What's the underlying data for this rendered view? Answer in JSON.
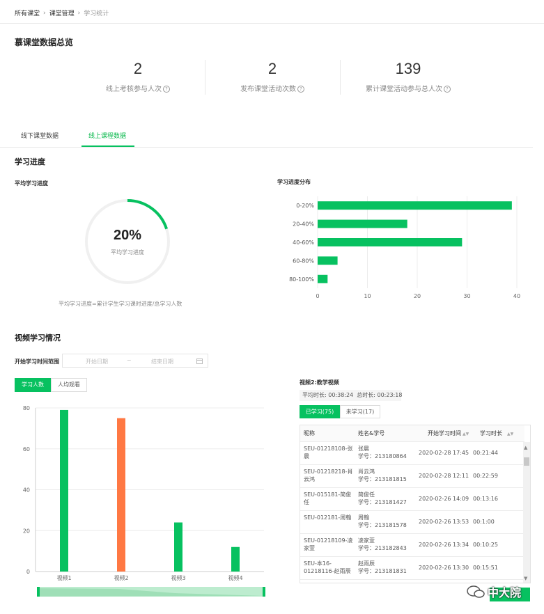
{
  "breadcrumb": [
    "所有课堂",
    "课堂管理",
    "学习统计"
  ],
  "overview": {
    "title": "慕课堂数据总览",
    "stats": [
      {
        "value": "2",
        "label": "线上考核参与人次"
      },
      {
        "value": "2",
        "label": "发布课堂活动次数"
      },
      {
        "value": "139",
        "label": "累计课堂活动参与总人次"
      }
    ],
    "help_glyph": "?"
  },
  "tabs": [
    {
      "label": "线下课堂数据",
      "active": false
    },
    {
      "label": "线上课程数据",
      "active": true
    }
  ],
  "progress": {
    "title": "学习进度",
    "avg_title": "平均学习进度",
    "avg_value": "20%",
    "avg_label": "平均学习进度",
    "formula": "平均学习进度=累计学生学习课时进度/总学习人数",
    "dist_title": "学习进度分布"
  },
  "chart_data": [
    {
      "type": "bar",
      "orientation": "horizontal",
      "title": "学习进度分布",
      "categories": [
        "0-20%",
        "20-40%",
        "40-60%",
        "60-80%",
        "80-100%"
      ],
      "values": [
        39,
        18,
        29,
        4,
        2
      ],
      "xlim": [
        0,
        40
      ],
      "xticks": [
        0,
        10,
        20,
        30,
        40
      ],
      "color": "#07c160",
      "grid": true
    },
    {
      "type": "bar",
      "title": "",
      "categories": [
        "视频1",
        "视频2",
        "视频3",
        "视频4"
      ],
      "values": [
        79,
        75,
        24,
        12
      ],
      "colors": [
        "#07c160",
        "#ff7843",
        "#07c160",
        "#07c160"
      ],
      "ylim": [
        0,
        80
      ],
      "yticks": [
        0,
        20,
        40,
        60,
        80
      ],
      "grid": true
    }
  ],
  "video": {
    "title": "视频学习情况",
    "range_label": "开始学习时间范围",
    "start_placeholder": "开始日期",
    "range_sep": "~",
    "end_placeholder": "结束日期",
    "calendar_icon": "calendar-icon",
    "btn_learners": "学习人数",
    "btn_avg": "人均观看"
  },
  "detail": {
    "title": "视频2:教学视频",
    "avg_time": "平均时长: 00:38:24",
    "total_time": "总时长: 00:23:18",
    "tab_learned": "已学习(75)",
    "tab_unlearned": "未学习(17)",
    "columns": [
      "昵称",
      "姓名&学号",
      "开始学习时间",
      "学习时长"
    ],
    "sort_icon": "sort-icon",
    "rows": [
      {
        "nick1": "SEU-01218108-张",
        "nick2": "晨",
        "name": "张晨",
        "sid": "学号：213180864",
        "start": "2020-02-28 17:45",
        "dur": "00:21:44"
      },
      {
        "nick1": "SEU-01218218-肖",
        "nick2": "云鸿",
        "name": "肖云鸿",
        "sid": "学号：213181815",
        "start": "2020-02-28 12:11",
        "dur": "00:22:59"
      },
      {
        "nick1": "SEU-015181-简俊",
        "nick2": "任",
        "name": "简俊任",
        "sid": "学号：213181427",
        "start": "2020-02-26 14:09",
        "dur": "00:13:16"
      },
      {
        "nick1": "SEU-012181-周翰",
        "nick2": "",
        "name": "周翰",
        "sid": "学号：213181578",
        "start": "2020-02-26 13:53",
        "dur": "00:1:00"
      },
      {
        "nick1": "SEU-01218109-凌",
        "nick2": "家萱",
        "name": "凌家萱",
        "sid": "学号：213182843",
        "start": "2020-02-26 13:34",
        "dur": "00:10:25"
      },
      {
        "nick1": "SEU-本16-",
        "nick2": "01218116-赵雨辰",
        "name": "赵雨辰",
        "sid": "学号：213181831",
        "start": "2020-02-26 13:30",
        "dur": "00:15:51"
      }
    ]
  },
  "watermark": "中大院"
}
